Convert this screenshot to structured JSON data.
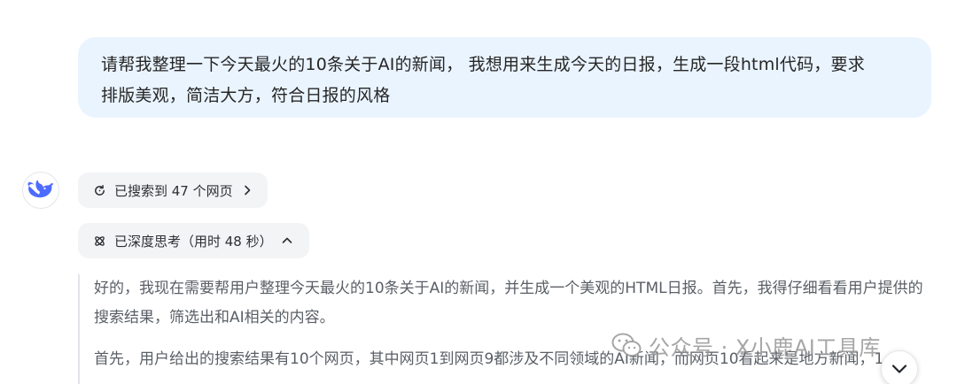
{
  "user_message": {
    "line1": "请帮我整理一下今天最火的10条关于AI的新闻， 我想用来生成今天的日报，生成一段html代码，要求",
    "line2": "排版美观，简洁大方，符合日报的风格"
  },
  "assistant": {
    "avatar_icon": "whale-logo-icon",
    "search_status": {
      "label": "已搜索到 47 个网页",
      "icon": "search-refresh-icon"
    },
    "thinking_status": {
      "label": "已深度思考（用时 48 秒）",
      "icon": "deep-think-icon"
    },
    "thinking_text": {
      "p1": "好的，我现在需要帮用户整理今天最火的10条关于AI的新闻，并生成一个美观的HTML日报。首先，我得仔细看看用户提供的搜索结果，筛选出和AI相关的内容。",
      "p2": "首先，用户给出的搜索结果有10个网页，其中网页1到网页9都涉及不同领域的AI新闻，而网页10看起来是地方新闻，1"
    }
  },
  "watermark": {
    "text": "公众号 · X小鹿AI工具库"
  },
  "colors": {
    "user_bubble_bg": "#eaf4ff",
    "pill_bg": "#f3f4f6",
    "logo_blue": "#4d6bfe",
    "thinking_text": "#5a5f66"
  }
}
